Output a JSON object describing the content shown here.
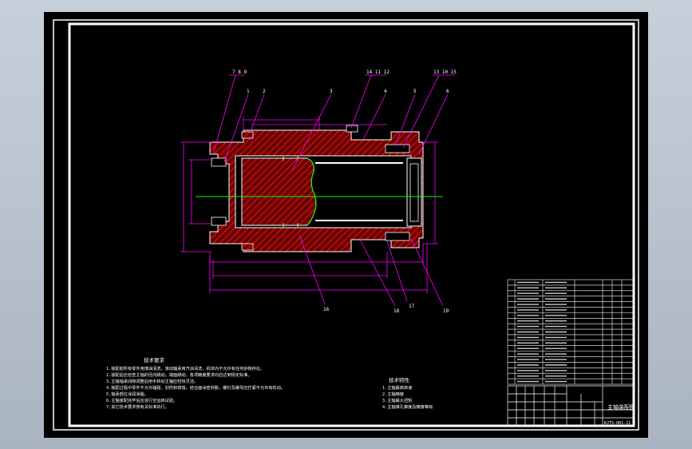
{
  "drawing": {
    "title": "主轴装配图",
    "code": "KJTS-001-11",
    "colors": {
      "background": "#000000",
      "frame": "#ffffff",
      "dimension": "#ff00ff",
      "hatch": "#ff0000",
      "centerline": "#00ff00",
      "outline": "#ffffff",
      "hidden_line": "#ffff00"
    },
    "labels": {
      "top": [
        "7 8 9",
        "1",
        "2",
        "3",
        "14 11 12",
        "4",
        "5",
        "13 10 15",
        "6"
      ],
      "bottom": [
        "16",
        "18",
        "17",
        "19"
      ]
    },
    "tech_requirements_title": "技术要求",
    "tech_requirements": [
      "1.装配前所有零件用煤油清洗，滚动轴承用汽油清洗，机体内不允许有任何杂物存在。",
      "2.装配后应检查主轴的径向跳动，端面跳动，各项精度要求均应达到规定标准。",
      "3.主轴轴承间隙调整后用手转动主轴应轻快灵活。",
      "4.装配过程中零件不允许磕碰，划伤和锈蚀，结合面涂密封胶，螺钉及螺母应拧紧不允许有松动。",
      "5.轴承部位涂润滑脂。",
      "6.主轴装配完毕后应进行空运转试验。",
      "7.其它技术要求按有关标准执行。"
    ],
    "tech_specs_title": "技术特性",
    "tech_specs": [
      "1.主轴最高转速",
      "2.主轴精度",
      "3.主轴最大扭矩",
      "4.主轴锥孔锥度及精度等级"
    ],
    "parts_rows": 19
  }
}
